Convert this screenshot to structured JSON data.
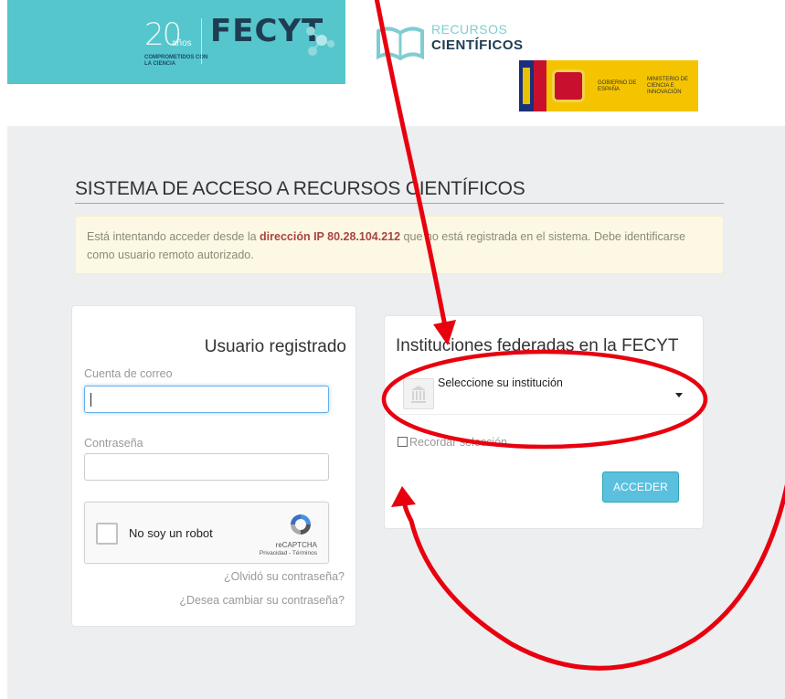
{
  "header": {
    "anios_number": "20",
    "anios_label": "años",
    "anios_tagline": "COMPROMETIDOS CON LA CIENCIA",
    "fecyt_logo": "FECYT",
    "recursos_line1": "RECURSOS",
    "recursos_line2": "CIENTÍFICOS",
    "gobierno_text": "GOBIERNO DE ESPAÑA",
    "ministerio_text": "MINISTERIO DE CIENCIA E INNOVACIÓN"
  },
  "page": {
    "title": "SISTEMA DE ACCESO A RECURSOS CIENTÍFICOS"
  },
  "alert": {
    "prefix": "Está intentando acceder desde la ",
    "ip_text": "dirección IP 80.28.104.212",
    "suffix": " que no está registrada en el sistema. Debe identificarse como usuario remoto autorizado."
  },
  "login": {
    "heading": "Usuario registrado",
    "email_label": "Cuenta de correo",
    "email_value": "",
    "password_label": "Contraseña",
    "password_value": "",
    "captcha_text": "No soy un robot",
    "captcha_brand": "reCAPTCHA",
    "captcha_links": "Privacidad - Términos",
    "forgot_link": "¿Olvidó su contraseña?",
    "change_link": "¿Desea cambiar su contraseña?"
  },
  "federated": {
    "heading": "Instituciones federadas en la FECYT",
    "select_value": "Seleccione su institución",
    "remember_label": "Recordar selección",
    "remember_checked": false,
    "submit_label": "ACCEDER"
  },
  "colors": {
    "accent": "#5bc0de",
    "banner": "#55c6cc",
    "annotation": "#e8000f",
    "alert_bg": "#fcf8e3",
    "ip_text": "#a94442"
  }
}
